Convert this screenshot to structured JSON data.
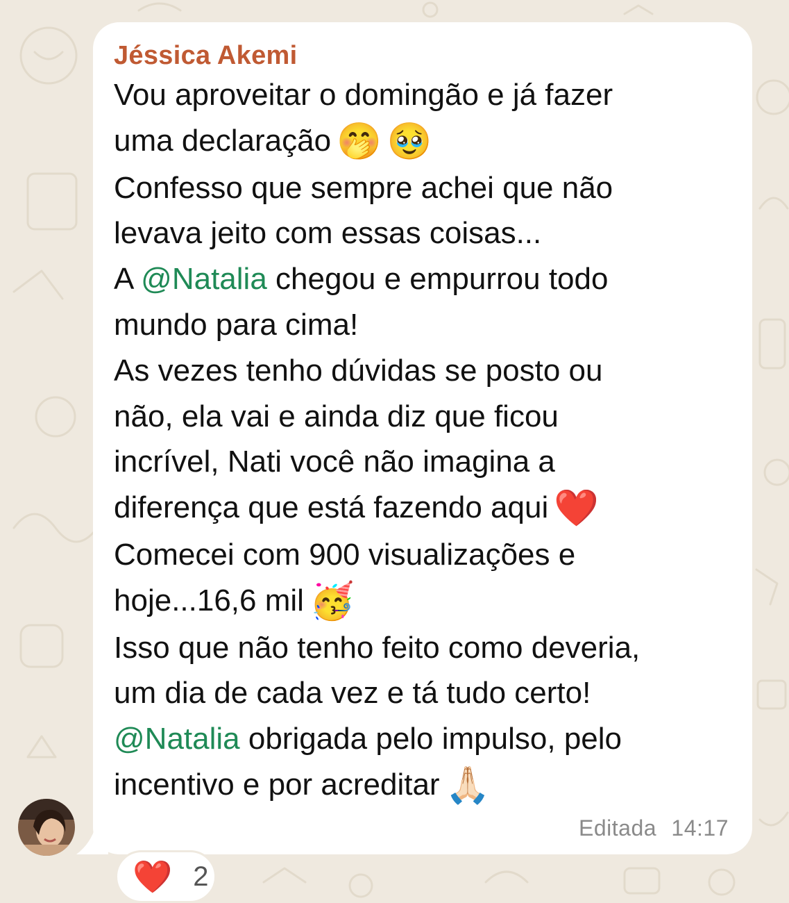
{
  "message": {
    "sender": "Jéssica Akemi",
    "lines": [
      [
        {
          "t": "Vou aproveitar o domingão e já fazer"
        }
      ],
      [
        {
          "t": "uma declaração"
        },
        {
          "e": "🤭"
        },
        {
          "e": "🥹"
        }
      ],
      [
        {
          "t": "Confesso que sempre achei que não"
        }
      ],
      [
        {
          "t": "levava jeito com essas coisas..."
        }
      ],
      [
        {
          "t": "A "
        },
        {
          "m": "@Natalia"
        },
        {
          "t": " chegou e empurrou todo"
        }
      ],
      [
        {
          "t": "mundo para cima!"
        }
      ],
      [
        {
          "t": "As vezes tenho dúvidas se posto ou"
        }
      ],
      [
        {
          "t": "não, ela vai e ainda diz que ficou"
        }
      ],
      [
        {
          "t": "incrível, Nati você não imagina a"
        }
      ],
      [
        {
          "t": "diferença que está fazendo aqui"
        },
        {
          "e": "❤️"
        }
      ],
      [
        {
          "t": "Comecei com 900 visualizações e"
        }
      ],
      [
        {
          "t": "hoje...16,6 mil"
        },
        {
          "e": "🥳"
        }
      ],
      [
        {
          "t": "Isso que não tenho feito como deveria,"
        }
      ],
      [
        {
          "t": "um dia de cada vez e tá tudo certo!"
        }
      ],
      [
        {
          "m": "@Natalia"
        },
        {
          "t": " obrigada pelo impulso, pelo"
        }
      ],
      [
        {
          "t": "incentivo e por acreditar"
        },
        {
          "e": "🙏🏻"
        }
      ]
    ],
    "edited_label": "Editada",
    "time": "14:17"
  },
  "reaction": {
    "emoji": "❤️",
    "count": "2"
  },
  "colors": {
    "background": "#efe9df",
    "bubble": "#ffffff",
    "sender": "#c05a33",
    "mention": "#1f8a56",
    "meta": "#8a8a8a"
  },
  "icons": {
    "avatar": "avatar-photo"
  }
}
